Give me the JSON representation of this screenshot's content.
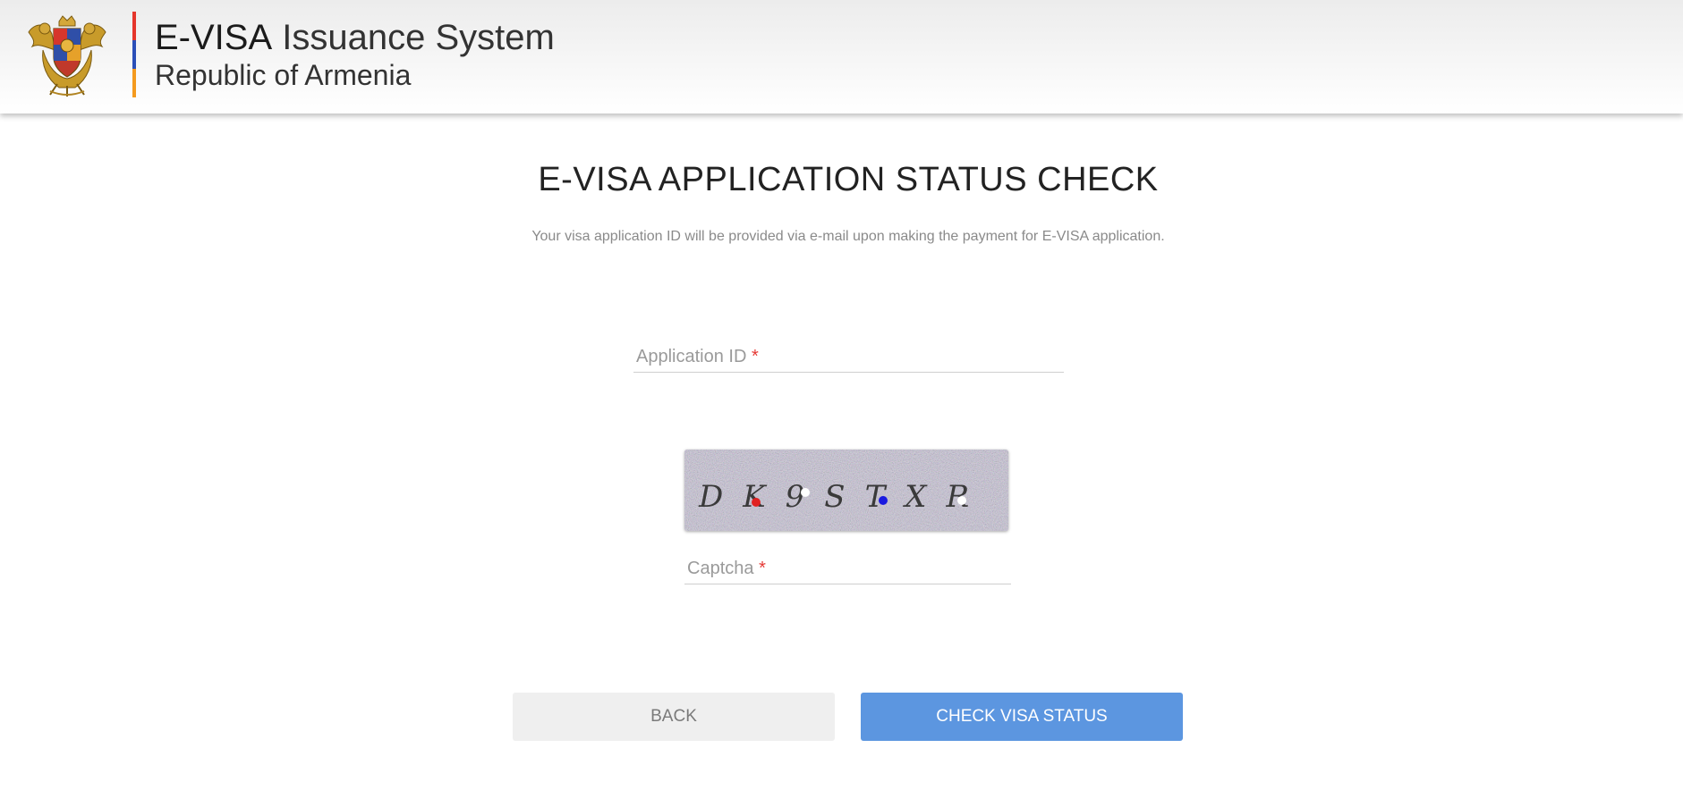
{
  "header": {
    "title_strong": "E-VISA",
    "title_rest": " Issuance System",
    "subtitle": "Republic of Armenia"
  },
  "flag_colors": [
    "#e5352b",
    "#2b4fb8",
    "#f49a1e"
  ],
  "page": {
    "title": "E-VISA APPLICATION STATUS CHECK",
    "note": "Your visa application ID will be provided via e-mail upon making the payment for E-VISA application."
  },
  "form": {
    "application_id": {
      "label": "Application ID",
      "required_mark": "*",
      "value": ""
    },
    "captcha_image_text": "DK9STXR",
    "captcha": {
      "label": "Captcha",
      "required_mark": "*",
      "value": ""
    }
  },
  "buttons": {
    "back": "BACK",
    "check": "CHECK VISA STATUS"
  }
}
